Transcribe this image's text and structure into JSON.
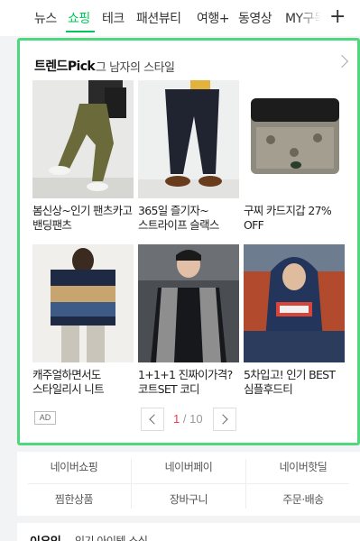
{
  "tabs": [
    {
      "label": "뉴스",
      "active": false
    },
    {
      "label": "쇼핑",
      "active": true
    },
    {
      "label": "테크",
      "active": false
    },
    {
      "label": "패션뷰티",
      "active": false
    },
    {
      "label": "여행+",
      "active": false
    },
    {
      "label": "동영상",
      "active": false
    },
    {
      "label": "MY구독",
      "active": false
    }
  ],
  "tab_add_icon": "plus-icon",
  "accent_color": "#03c75a",
  "card": {
    "brand": "트렌드Pick",
    "subtitle": "그 남자의 스타일",
    "more_icon": "chevron-right-icon",
    "border_color": "#4ed77c",
    "products": [
      {
        "caption": "봄신상~인기 팬츠카고 밴딩팬츠"
      },
      {
        "caption": "365일 즐기자~스트라이프 슬랙스"
      },
      {
        "caption": "구찌 카드지갑 27% OFF"
      },
      {
        "caption": "캐주얼하면서도 스타일리시 니트"
      },
      {
        "caption": "1+1+1 진짜이가격? 코트SET 코디"
      },
      {
        "caption": "5차입고! 인기 BEST 심플후드티"
      }
    ],
    "ad_label": "AD",
    "pager": {
      "current": "1",
      "total": "/ 10"
    }
  },
  "links": [
    [
      "네이버쇼핑",
      "네이버페이",
      "네이버핫딜"
    ],
    [
      "찜한상품",
      "장바구니",
      "주문·배송"
    ]
  ],
  "bottom": {
    "title": "이유있",
    "subtitle": "인기 아이템 소식"
  }
}
